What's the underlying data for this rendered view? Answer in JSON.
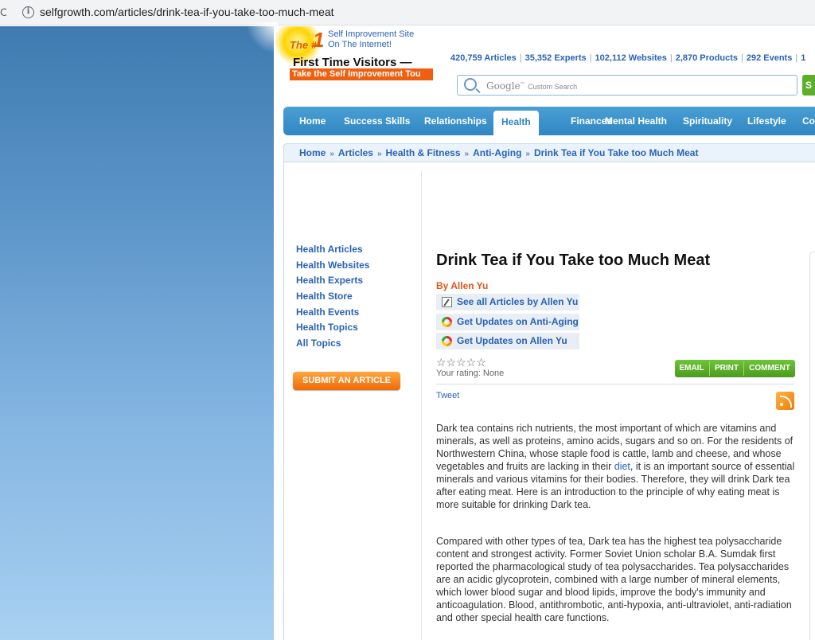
{
  "browser": {
    "url": "selfgrowth.com/articles/drink-tea-if-you-take-too-much-meat"
  },
  "header": {
    "logo_the": "The",
    "logo_hash": "#",
    "logo_one": "1",
    "logo_line1": "Self Improvement Site",
    "logo_line2": "On The Internet!",
    "first_time": "First Time Visitors —",
    "tour": "Take the Self Improvement Tou",
    "stats": [
      "420,759 Articles",
      "35,352 Experts",
      "102,112 Websites",
      "2,870 Products",
      "292 Events",
      "1"
    ],
    "search_google": "Google",
    "search_tm": "™",
    "search_placeholder": "Custom Search",
    "search_button": "S"
  },
  "nav": {
    "tabs": [
      "Home",
      "Success Skills",
      "Relationships",
      "Health",
      "Finances",
      "Mental Health",
      "Spirituality",
      "Lifestyle",
      "Co"
    ],
    "active": "Health"
  },
  "breadcrumb": [
    "Home",
    "Articles",
    "Health & Fitness",
    "Anti-Aging",
    "Drink Tea if You Take too Much Meat"
  ],
  "sidebar": {
    "links": [
      "Health Articles",
      "Health Websites",
      "Health Experts",
      "Health Store",
      "Health Events",
      "Health Topics",
      "All Topics"
    ],
    "submit_label": "SUBMIT AN ARTICLE"
  },
  "article": {
    "title": "Drink Tea if You Take too Much Meat",
    "byline": "By Allen Yu",
    "actions": [
      "See all Articles by Allen Yu",
      "Get Updates on Anti-Aging",
      "Get Updates on Allen Yu"
    ],
    "stars": "☆☆☆☆☆",
    "rating": "Your rating: None",
    "share": [
      "EMAIL",
      "PRINT",
      "COMMENT"
    ],
    "tweet": "Tweet",
    "p1_a": "Dark tea contains rich nutrients, the most important of which are vitamins and minerals, as well as proteins, amino acids, sugars and so on. For the residents of Northwestern China, whose staple food is cattle, lamb and cheese, and whose vegetables and fruits are lacking in their ",
    "p1_link": "diet",
    "p1_b": ", it is an important source of essential minerals and various vitamins for their bodies. Therefore, they will drink Dark tea after eating meat. Here is an introduction to the principle of why eating meat is more suitable for drinking Dark tea.",
    "p2": "Compared with other types of tea, Dark tea has the highest tea polysaccharide content and strongest activity. Former Soviet Union scholar B.A. Sumdak first reported the pharmacological study of tea polysaccharides. Tea polysaccharides are an acidic glycoprotein, combined with a large number of mineral elements, which lower blood sugar and blood lipids, improve the body's immunity and anticoagulation. Blood, antithrombotic, anti-hypoxia, anti-ultraviolet, anti-radiation and other special health care functions."
  }
}
